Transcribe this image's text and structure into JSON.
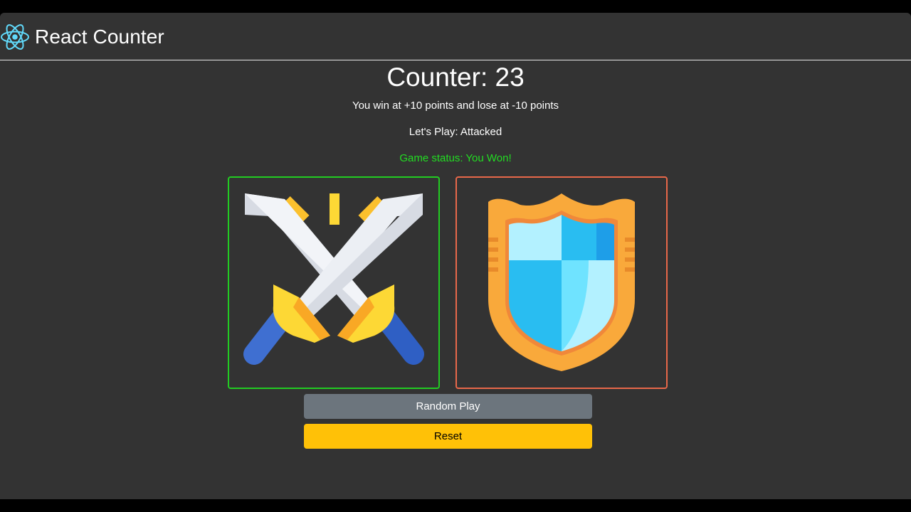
{
  "navbar": {
    "logo_icon": "react-logo-icon",
    "title": "React Counter",
    "logo_color": "#61dafb"
  },
  "counter": {
    "title": "Counter: 23"
  },
  "rules": {
    "text": "You win at +10 points and lose at -10 points"
  },
  "play": {
    "text": "Let's Play: Attacked"
  },
  "status": {
    "text": "Game status: You Won!",
    "color": "#22dd22"
  },
  "cards": {
    "attack": {
      "icon": "crossed-swords-icon",
      "border_color": "#22cc22"
    },
    "defend": {
      "icon": "shield-icon",
      "border_color": "#e8684a"
    }
  },
  "buttons": {
    "random_play": "Random Play",
    "reset": "Reset"
  },
  "colors": {
    "background": "#333333",
    "secondary": "#6c757d",
    "warning": "#ffc107"
  }
}
